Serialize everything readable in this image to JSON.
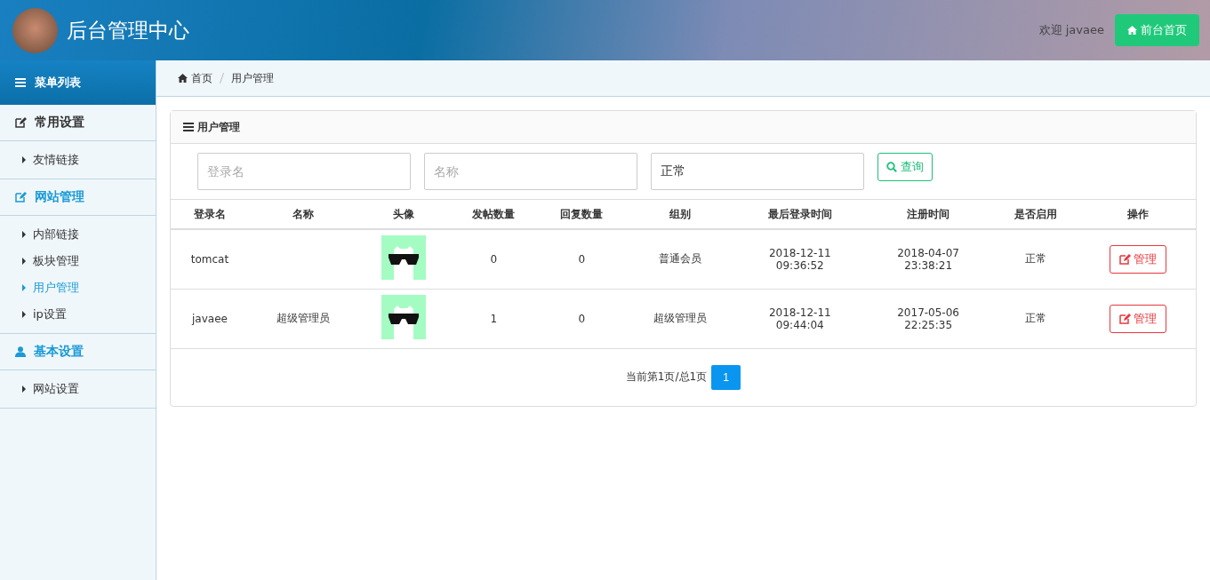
{
  "header": {
    "title": "后台管理中心",
    "welcome": "欢迎 javaee",
    "home_button": "前台首页"
  },
  "sidebar": {
    "title": "菜单列表",
    "groups": [
      {
        "label": "常用设置",
        "kind": "edit",
        "active": false,
        "items": [
          {
            "label": "友情链接",
            "selected": false
          }
        ]
      },
      {
        "label": "网站管理",
        "kind": "edit",
        "active": true,
        "items": [
          {
            "label": "内部链接",
            "selected": false
          },
          {
            "label": "板块管理",
            "selected": false
          },
          {
            "label": "用户管理",
            "selected": true
          },
          {
            "label": "ip设置",
            "selected": false
          }
        ]
      },
      {
        "label": "基本设置",
        "kind": "user",
        "active": true,
        "items": [
          {
            "label": "网站设置",
            "selected": false
          }
        ]
      }
    ]
  },
  "breadcrumb": [
    "首页",
    "用户管理"
  ],
  "panel": {
    "title": "用户管理",
    "search": [
      {
        "placeholder": "登录名"
      },
      {
        "placeholder": "名称"
      },
      {
        "value": "正常"
      }
    ],
    "search_button": "查询",
    "table": {
      "columns": [
        "登录名",
        "名称",
        "头像",
        "发帖数量",
        "回复数量",
        "组别",
        "最后登录时间",
        "注册时间",
        "是否启用",
        "操作"
      ],
      "rows": [
        {
          "login": "tomcat",
          "posts": "0",
          "replies": "0",
          "group": "普通会员",
          "last_login": [
            "2018-12-11",
            "09:36:52"
          ],
          "registered": [
            "2018-04-07",
            "23:38:21"
          ],
          "status": "正常",
          "action": "管理"
        },
        {
          "login": "javaee",
          "name": "超级管理员",
          "posts": "1",
          "replies": "0",
          "group": "超级管理员",
          "last_login": [
            "2018-12-11",
            "09:44:04"
          ],
          "registered": [
            "2017-05-06",
            "22:25:35"
          ],
          "status": "正常",
          "action": "管理"
        }
      ]
    },
    "pagination": {
      "info": "当前第1页/总1页",
      "pages": [
        {
          "label": "1",
          "selected": true
        }
      ]
    }
  }
}
